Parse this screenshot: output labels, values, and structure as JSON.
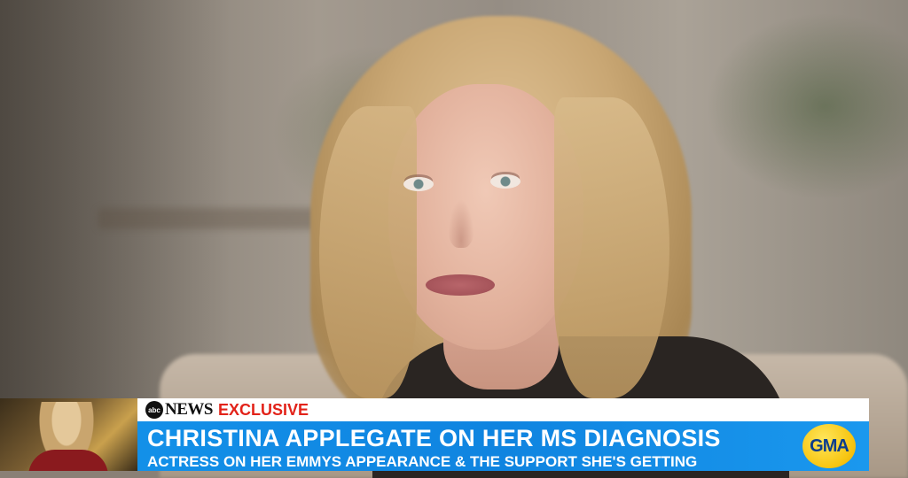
{
  "network": {
    "logo_text": "abc",
    "name": "NEWS",
    "tag": "EXCLUSIVE"
  },
  "banner": {
    "headline": "CHRISTINA APPLEGATE ON HER MS DIAGNOSIS",
    "subline": "ACTRESS ON HER EMMYS APPEARANCE & THE SUPPORT SHE'S GETTING"
  },
  "show_logo": "GMA",
  "colors": {
    "banner_blue": "#1390e8",
    "exclusive_red": "#e2231a",
    "gma_yellow": "#f7c613"
  }
}
